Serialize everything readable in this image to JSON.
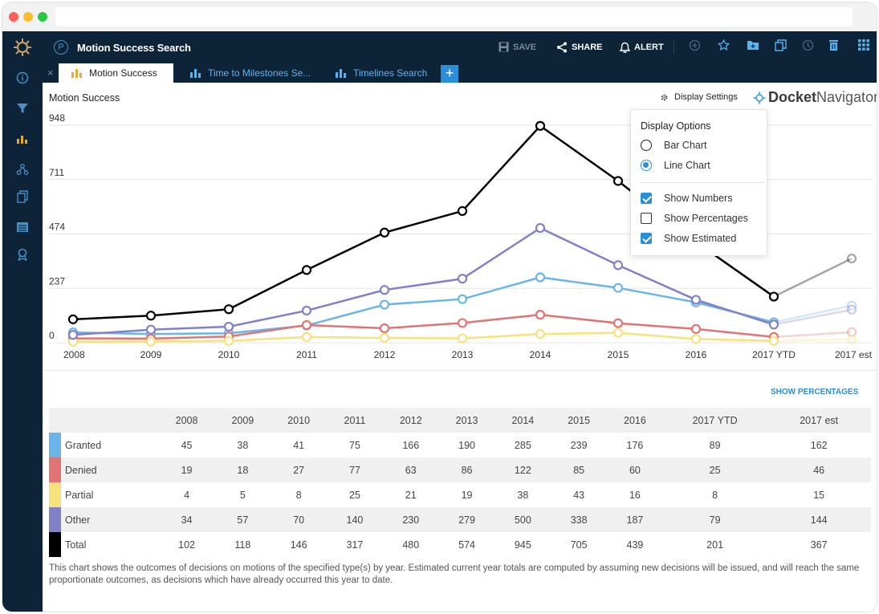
{
  "app": {
    "title": "Motion Success Search",
    "brand_left": "Docket",
    "brand_right": "Navigator"
  },
  "toolbar": {
    "save_label": "SAVE",
    "share_label": "SHARE",
    "alert_label": "ALERT"
  },
  "tabs": [
    {
      "label": "Motion Success",
      "active": true
    },
    {
      "label": "Time to Milestones Se...",
      "active": false
    },
    {
      "label": "Timelines Search",
      "active": false
    }
  ],
  "tab_close": "×",
  "tab_add": "+",
  "page": {
    "title": "Motion Success",
    "display_settings_label": "Display Settings",
    "show_percentages_link": "SHOW PERCENTAGES",
    "footnote": "This chart shows the outcomes of decisions on motions of the specified type(s) by year. Estimated current year totals are computed by assuming new decisions will be issued, and will reach the same proportionate outcomes, as decisions which have already occurred this year to date."
  },
  "display_options": {
    "heading": "Display Options",
    "bar_chart": "Bar Chart",
    "line_chart": "Line Chart",
    "show_numbers": "Show Numbers",
    "show_percentages": "Show Percentages",
    "show_estimated": "Show Estimated",
    "selected_chart": "line",
    "show_numbers_checked": true,
    "show_percentages_checked": false,
    "show_estimated_checked": true
  },
  "chart_data": {
    "type": "line",
    "categories": [
      "2008",
      "2009",
      "2010",
      "2011",
      "2012",
      "2013",
      "2014",
      "2015",
      "2016",
      "2017 YTD",
      "2017 est"
    ],
    "y_ticks": [
      "0",
      "237",
      "474",
      "711",
      "948"
    ],
    "ylim": [
      0,
      948
    ],
    "grid": true,
    "estimated_category": "2017 est",
    "series": [
      {
        "name": "Granted",
        "color": "#6ab4ea",
        "values": [
          45,
          38,
          41,
          75,
          166,
          190,
          285,
          239,
          176,
          89,
          162
        ]
      },
      {
        "name": "Denied",
        "color": "#e07474",
        "values": [
          19,
          18,
          27,
          77,
          63,
          86,
          122,
          85,
          60,
          25,
          46
        ]
      },
      {
        "name": "Partial",
        "color": "#f7e17c",
        "values": [
          4,
          5,
          8,
          25,
          21,
          19,
          38,
          43,
          16,
          8,
          15
        ]
      },
      {
        "name": "Other",
        "color": "#8281c8",
        "values": [
          34,
          57,
          70,
          140,
          230,
          279,
          500,
          338,
          187,
          79,
          144
        ]
      },
      {
        "name": "Total",
        "color": "#000000",
        "values": [
          102,
          118,
          146,
          317,
          480,
          574,
          945,
          705,
          439,
          201,
          367
        ]
      }
    ]
  }
}
